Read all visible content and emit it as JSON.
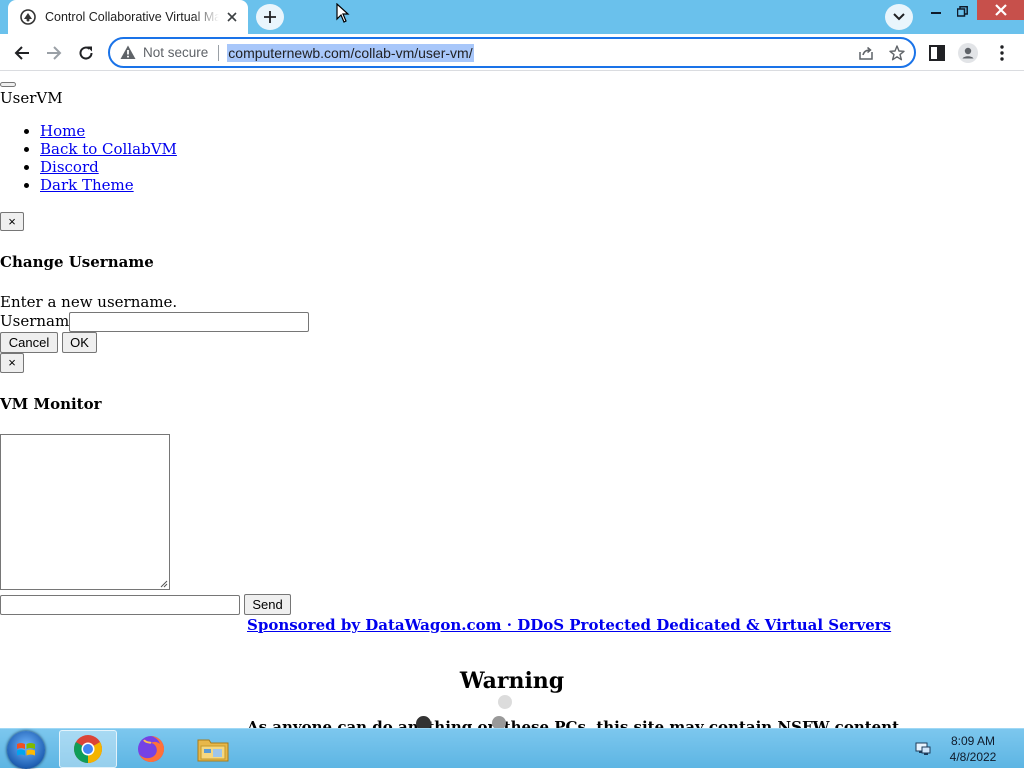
{
  "browser": {
    "tab_title": "Control Collaborative Virtual Machines",
    "security_label": "Not secure",
    "url": "computernewb.com/collab-vm/user-vm/"
  },
  "page": {
    "brand": "UserVM",
    "nav_links": [
      "Home",
      "Back to CollabVM",
      "Discord",
      "Dark Theme"
    ],
    "close_glyph": "×",
    "username_dialog": {
      "title": "Change Username",
      "prompt": "Enter a new username.",
      "field_label": "Username",
      "field_value": "",
      "cancel_label": "Cancel",
      "ok_label": "OK"
    },
    "monitor_dialog": {
      "title": "VM Monitor",
      "textarea_value": "",
      "input_value": "",
      "send_label": "Send"
    },
    "sponsor_text": "Sponsored by DataWagon.com · DDoS Protected Dedicated & Virtual Servers",
    "warning_title": "Warning",
    "warning_text": "As anyone can do anything on these PCs, this site may contain NSFW content."
  },
  "taskbar": {
    "time": "8:09 AM",
    "date": "4/8/2022",
    "apps": [
      "chrome-icon",
      "firefox-icon",
      "explorer-icon"
    ]
  },
  "colors": {
    "titlebar": "#6ac1ec",
    "omnibox_focus": "#1a73e8",
    "link": "#0000ee",
    "taskbar": "#5db5e3"
  }
}
